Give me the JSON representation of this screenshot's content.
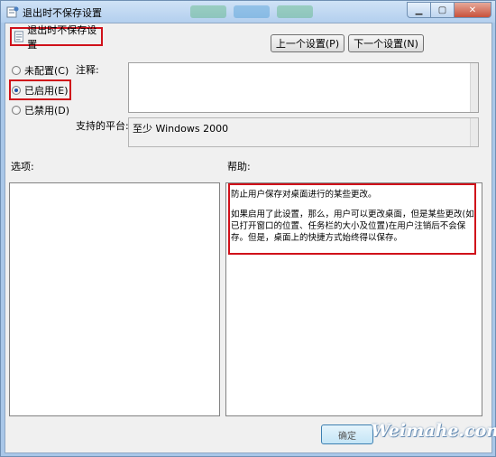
{
  "window": {
    "title": "退出时不保存设置",
    "title_bar_buttons": [
      "minimize-icon",
      "maximize-icon",
      "close-icon"
    ]
  },
  "header": {
    "setting_name": "退出时不保存设置",
    "prev_button": "上一个设置(P)",
    "next_button": "下一个设置(N)"
  },
  "options": {
    "radios": [
      {
        "label": "未配置(C)",
        "checked": false
      },
      {
        "label": "已启用(E)",
        "checked": true
      },
      {
        "label": "已禁用(D)",
        "checked": false
      }
    ]
  },
  "labels": {
    "comment": "注释:",
    "platform": "支持的平台:",
    "options": "选项:",
    "help": "帮助:"
  },
  "comment_value": "",
  "platform_value": "至少 Windows 2000",
  "help": {
    "paragraphs": [
      "防止用户保存对桌面进行的某些更改。",
      "如果启用了此设置，那么，用户可以更改桌面，但是某些更改(如已打开窗口的位置、任务栏的大小及位置)在用户注销后不会保存。但是，桌面上的快捷方式始终得以保存。"
    ]
  },
  "footer": {
    "ok_button": "确定"
  },
  "watermark": "Weimahe.com",
  "colors": {
    "highlight": "#d0111a",
    "title_bar": "#b3cfee",
    "radio_dot": "#1f55a8"
  }
}
